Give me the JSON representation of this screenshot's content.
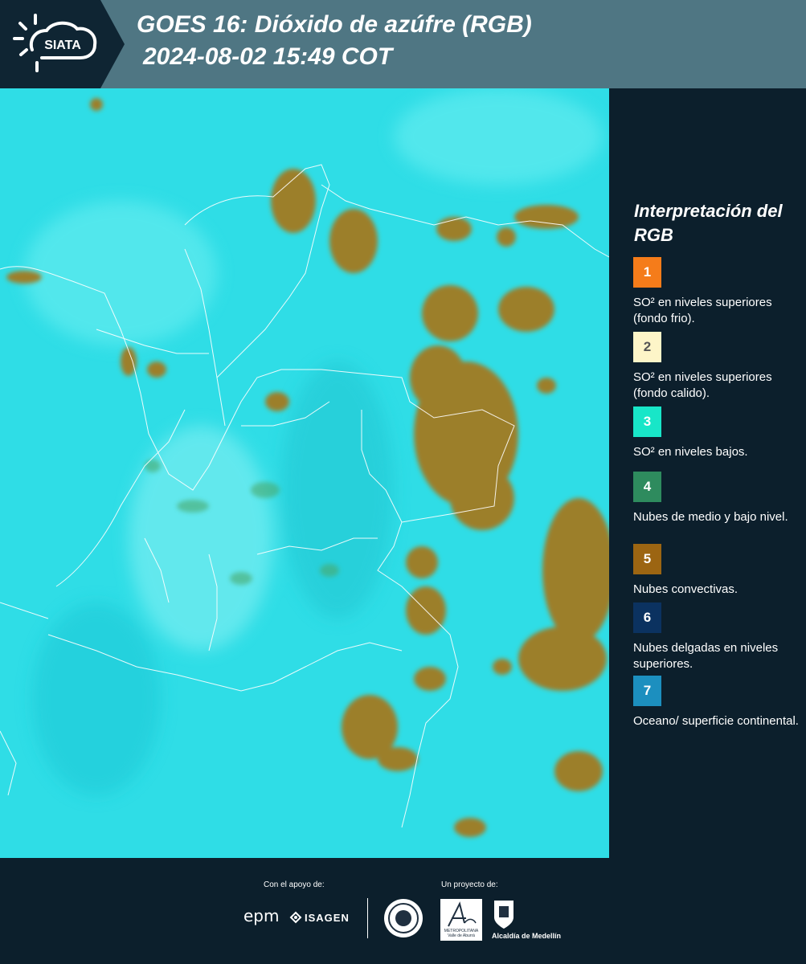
{
  "header": {
    "logo_text": "SIATA",
    "title": "GOES 16: Dióxido de azúfre (RGB)",
    "datetime": "2024-08-02 15:49 COT"
  },
  "legend": {
    "title": "Interpretación del RGB",
    "items": [
      {
        "number": "1",
        "color": "#f57c1a",
        "label": "SO² en niveles superiores (fondo frio)."
      },
      {
        "number": "2",
        "color": "#fdf5c8",
        "label": "SO² en niveles superiores (fondo calido)."
      },
      {
        "number": "3",
        "color": "#18e6c8",
        "label": "SO² en niveles bajos."
      },
      {
        "number": "4",
        "color": "#2e8b5e",
        "label": "Nubes de medio y bajo nivel."
      },
      {
        "number": "5",
        "color": "#9c6512",
        "label": "Nubes convectivas."
      },
      {
        "number": "6",
        "color": "#0b3260",
        "label": "Nubes delgadas en niveles superiores."
      },
      {
        "number": "7",
        "color": "#1c8fbf",
        "label": "Oceano/ superficie continental."
      }
    ]
  },
  "map": {
    "background_color": "#2fdde6",
    "cloud_color": "#9c7f2c",
    "border_color": "#ffffff"
  },
  "footer": {
    "support_label": "Con el apoyo de:",
    "project_label": "Un proyecto de:",
    "sponsors": [
      "epm",
      "ISAGEN"
    ],
    "partners": {
      "metro_caption": "METROPOLITANA Valle de Aburrá",
      "alcaldia": "Alcaldía de Medellín"
    }
  }
}
